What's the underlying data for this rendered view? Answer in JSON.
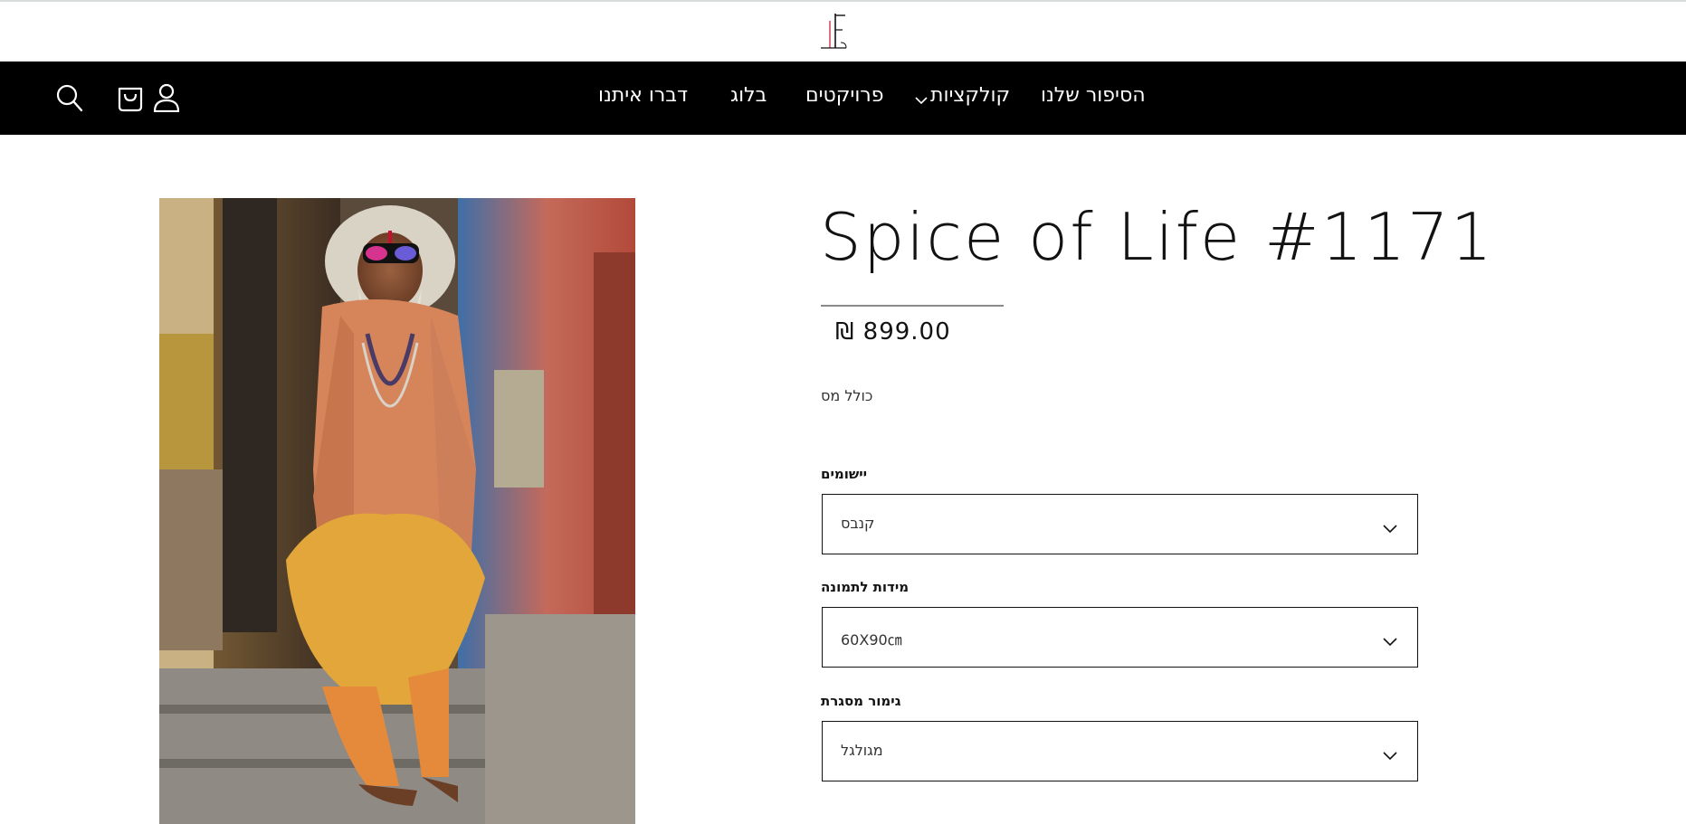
{
  "header": {
    "logo_alt": "LF logo"
  },
  "nav": {
    "items": [
      {
        "label": "הסיפור שלנו"
      },
      {
        "label": "קולקציות"
      },
      {
        "label": "פרויקטים"
      },
      {
        "label": "בלוג"
      },
      {
        "label": "דברו איתנו"
      }
    ],
    "icons": [
      "search-icon",
      "cart-icon",
      "account-icon"
    ]
  },
  "product": {
    "title": "Spice of Life #1171",
    "price": "₪ 899.00",
    "tax_note": "כולל מס",
    "image_description_icon": "product-image",
    "options": [
      {
        "label": "יישומים",
        "value": "קנבס"
      },
      {
        "label": "מידות לתמונה",
        "value": "60X90㎝"
      },
      {
        "label": "גימור מסגרת",
        "value": "מגולגל"
      }
    ]
  },
  "colors": {
    "nav_bg": "#000000",
    "nav_text": "#ffffff",
    "text": "#121212"
  }
}
